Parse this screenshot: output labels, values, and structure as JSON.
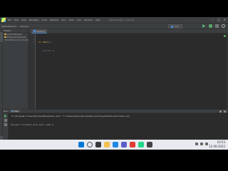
{
  "menu": {
    "items": [
      "File",
      "Edit",
      "View",
      "Navigate",
      "Code",
      "Refactor",
      "Run",
      "Tools",
      "VCS",
      "Window",
      "Help"
    ],
    "title": "pythonProject - main.py"
  },
  "breadcrumb": [
    "pythonProject",
    "main.py"
  ],
  "run_config": "main",
  "project_panel": {
    "header": "Project",
    "items": [
      "pythonProject",
      "External Libraries",
      "Scratches and Consoles"
    ]
  },
  "editor": {
    "tab": "main.py",
    "gutter": [
      "1",
      "2",
      "3"
    ],
    "code": {
      "l1_kw": "def",
      "l1_fn": " main",
      "l1_rest": "():",
      "l2_indent": "    ",
      "l2_fn": "print",
      "l2_open": "(",
      "l2_str": "\"\"",
      "l2_close": ")"
    }
  },
  "run": {
    "label": "Run:",
    "tab": "main",
    "console": [
      "\"C:\\Program Files\\Python310\\python.exe\" \"C:\\Users\\User\\PycharmProjects\\pythonProject\\main.py\"",
      "",
      "",
      "Process finished with exit code 0"
    ]
  },
  "status": {
    "left": "Indexing completed",
    "right": "3:1  CRLF  UTF-8  4 spaces  Python 3.10"
  },
  "taskbar": {
    "time": "10:53",
    "date": "12.09.2022"
  }
}
